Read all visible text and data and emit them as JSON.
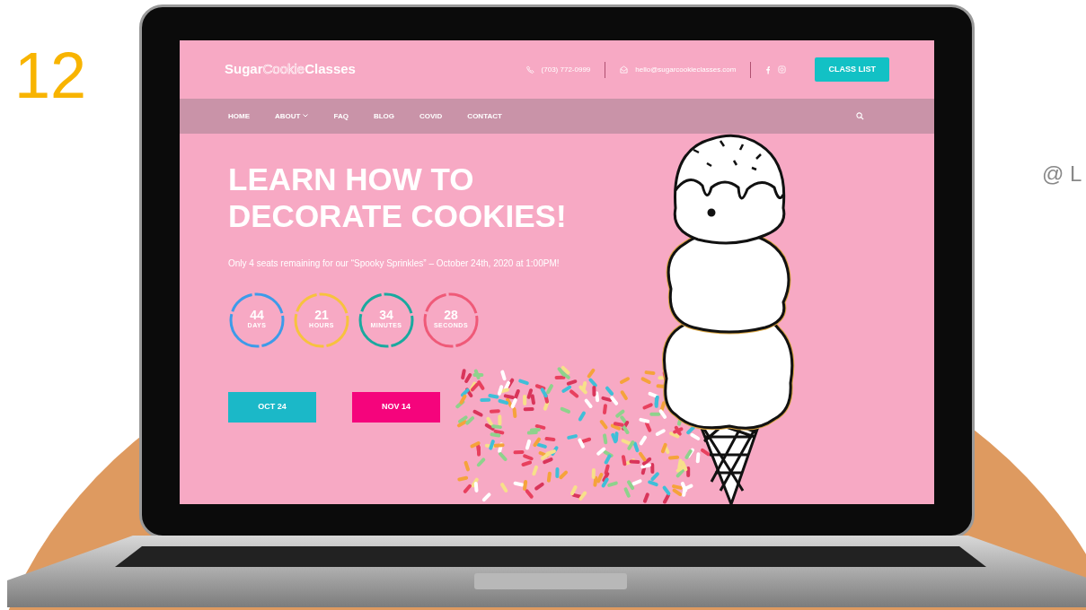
{
  "slide_number": "12",
  "corner_text": "@ L",
  "site": {
    "logo": [
      "Sugar",
      "Cookie",
      "Classes"
    ],
    "phone": "(703) 772-0999",
    "email": "hello@sugarcookieclasses.com",
    "class_list_button": "CLASS LIST",
    "nav": [
      {
        "label": "HOME",
        "dropdown": false
      },
      {
        "label": "ABOUT",
        "dropdown": true
      },
      {
        "label": "FAQ",
        "dropdown": false
      },
      {
        "label": "BLOG",
        "dropdown": false
      },
      {
        "label": "COVID",
        "dropdown": false
      },
      {
        "label": "CONTACT",
        "dropdown": false
      }
    ],
    "hero": {
      "title": [
        "LEARN HOW TO",
        "DECORATE COOKIES!"
      ],
      "subtitle": "Only 4 seats remaining for our “Spooky Sprinkles” – October 24th, 2020 at 1:00PM!",
      "countdown": [
        {
          "value": "44",
          "unit": "DAYS",
          "color": "#3d9be9"
        },
        {
          "value": "21",
          "unit": "HOURS",
          "color": "#f7c23e"
        },
        {
          "value": "34",
          "unit": "MINUTES",
          "color": "#1aa99f"
        },
        {
          "value": "28",
          "unit": "SECONDS",
          "color": "#ef5a78"
        }
      ],
      "buttons": [
        {
          "label": "OCT 24",
          "color": "#1bb8c8"
        },
        {
          "label": "NOV 14",
          "color": "#f5047c"
        }
      ]
    }
  }
}
